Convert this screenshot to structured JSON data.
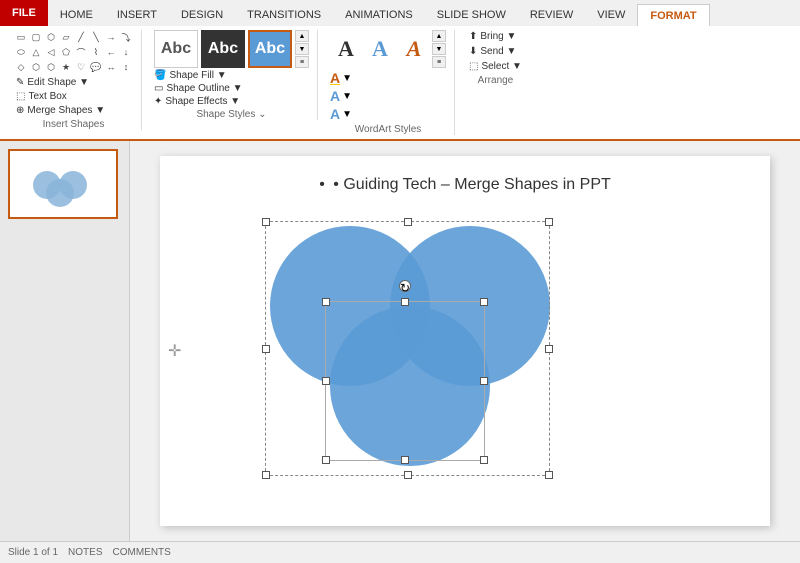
{
  "tabs": {
    "file": "FILE",
    "home": "HOME",
    "insert": "INSERT",
    "design": "DESIGN",
    "transitions": "TRANSITIONS",
    "animations": "ANIMATIONS",
    "slideshow": "SLIDE SHOW",
    "review": "REVIEW",
    "view": "VIEW",
    "format": "FORMAT"
  },
  "ribbon": {
    "insert_shapes": {
      "label": "Insert Shapes",
      "edit_shape": "Edit Shape ▼",
      "text_box": "Text Box",
      "merge_shapes": "Merge Shapes ▼"
    },
    "shape_styles": {
      "label": "Shape Styles",
      "shape_fill": "Shape Fill ▼",
      "shape_outline": "Shape Outline ▼",
      "shape_effects": "Shape Effects ▼"
    },
    "wordart_styles": {
      "label": "WordArt Styles"
    },
    "arrange": {
      "label": "Arrange",
      "bring": "Bring ▼",
      "send": "Send ▼",
      "select": "Select ▼"
    }
  },
  "slide": {
    "title_text": "• Guiding Tech – Merge Shapes in PPT",
    "slide_number": "1"
  },
  "status": {
    "slide_info": "Slide 1 of 1",
    "notes": "NOTES",
    "comments": "COMMENTS"
  }
}
